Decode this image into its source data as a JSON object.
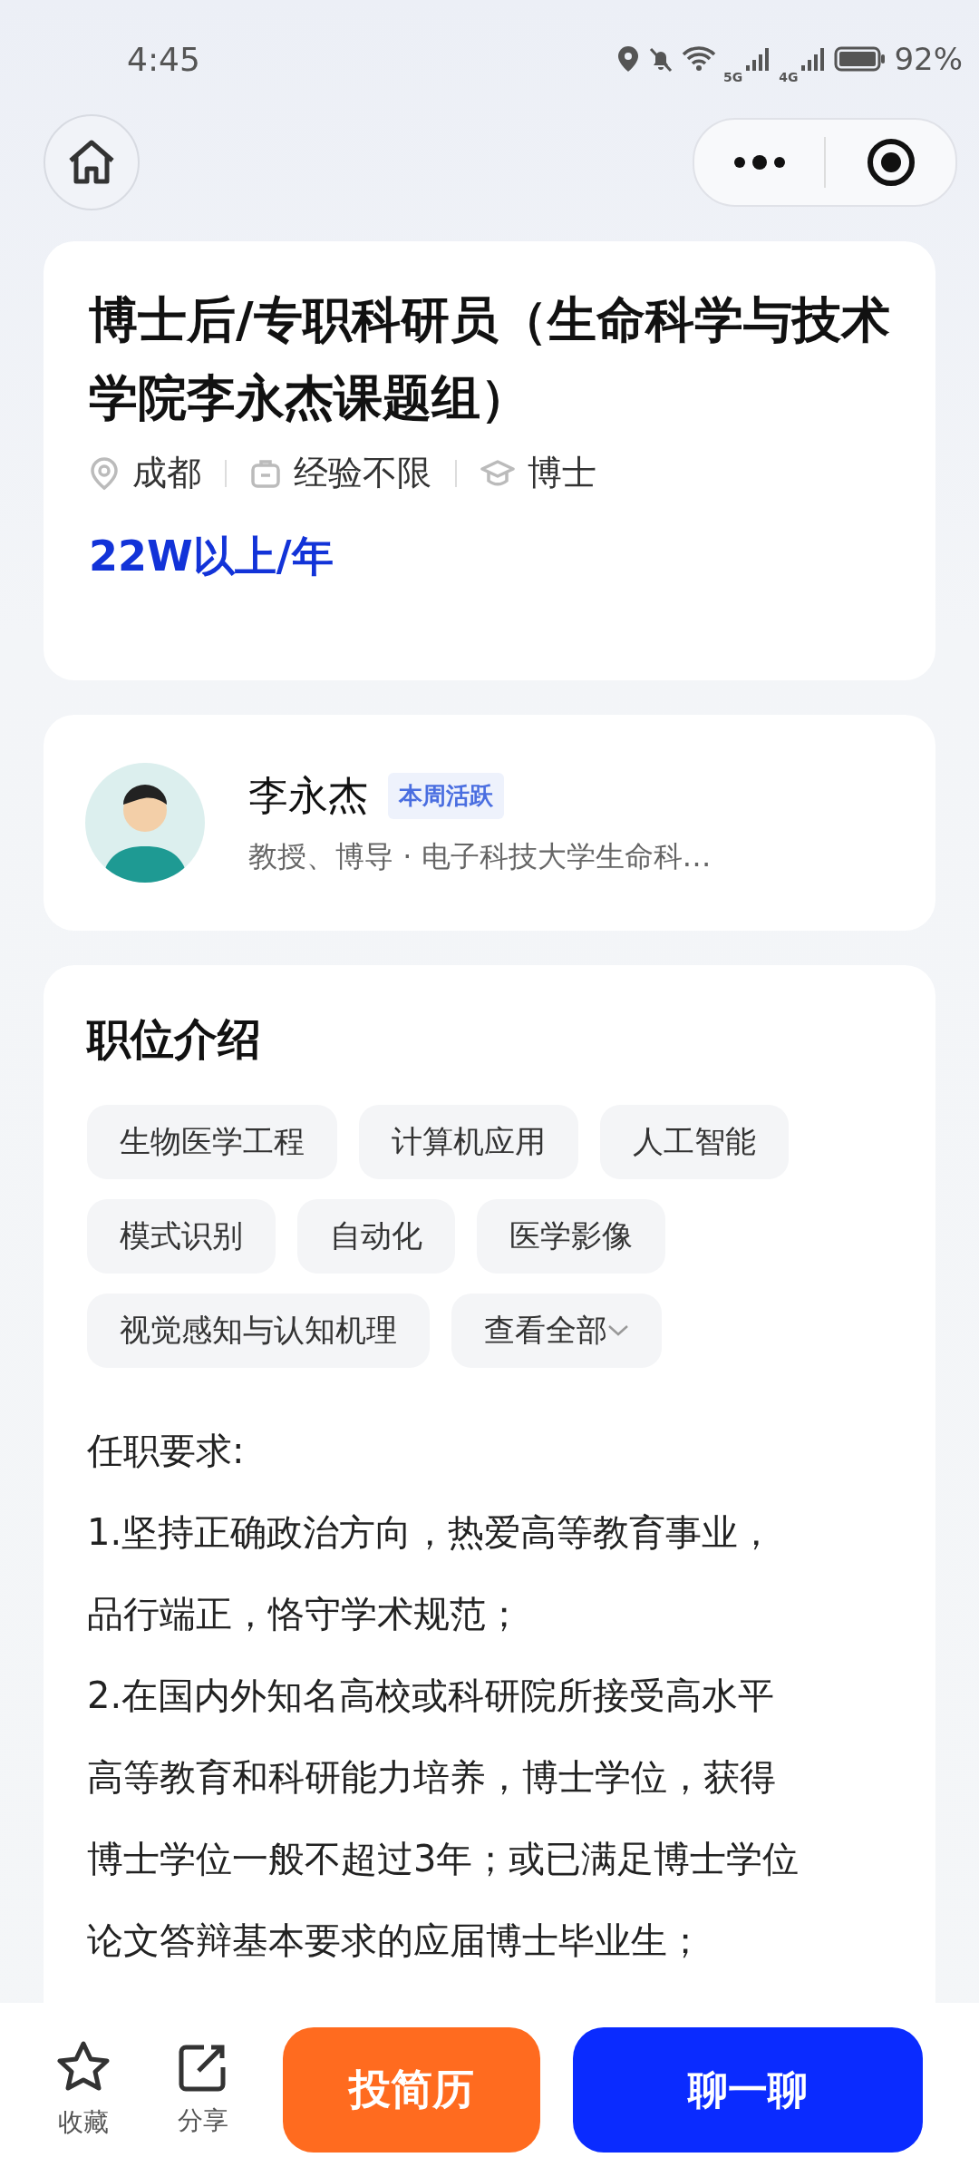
{
  "status_bar": {
    "time": "4:45",
    "network_1": "5G",
    "network_2": "4G",
    "battery": "92%"
  },
  "job": {
    "title": "博士后/专职科研员（生命科学与技术学院李永杰课题组）",
    "meta": [
      {
        "kind": "location",
        "text": "成都"
      },
      {
        "kind": "experience",
        "text": "经验不限"
      },
      {
        "kind": "degree",
        "text": "博士"
      }
    ],
    "salary": "22W以上/年"
  },
  "recruiter": {
    "name": "李永杰",
    "badge": "本周活跃",
    "subtitle": "教授、博导 · 电子科技大学生命科…"
  },
  "intro": {
    "heading": "职位介绍",
    "tags": [
      "生物医学工程",
      "计算机应用",
      "人工智能",
      "模式识别",
      "自动化",
      "医学影像",
      "视觉感知与认知机理"
    ],
    "more": "查看全部",
    "lines": [
      "任职要求:",
      "1.坚持正确政治方向，热爱高等教育事业，",
      "品行端正，恪守学术规范；",
      "2.在国内外知名高校或科研院所接受高水平",
      "高等教育和科研能力培养，博士学位，获得",
      "博士学位一般不超过3年；或已满足博士学位",
      "论文答辩基本要求的应届博士毕业生；"
    ]
  },
  "bottom_bar": {
    "favorite": "收藏",
    "share": "分享",
    "apply": "投简历",
    "chat": "聊一聊"
  }
}
